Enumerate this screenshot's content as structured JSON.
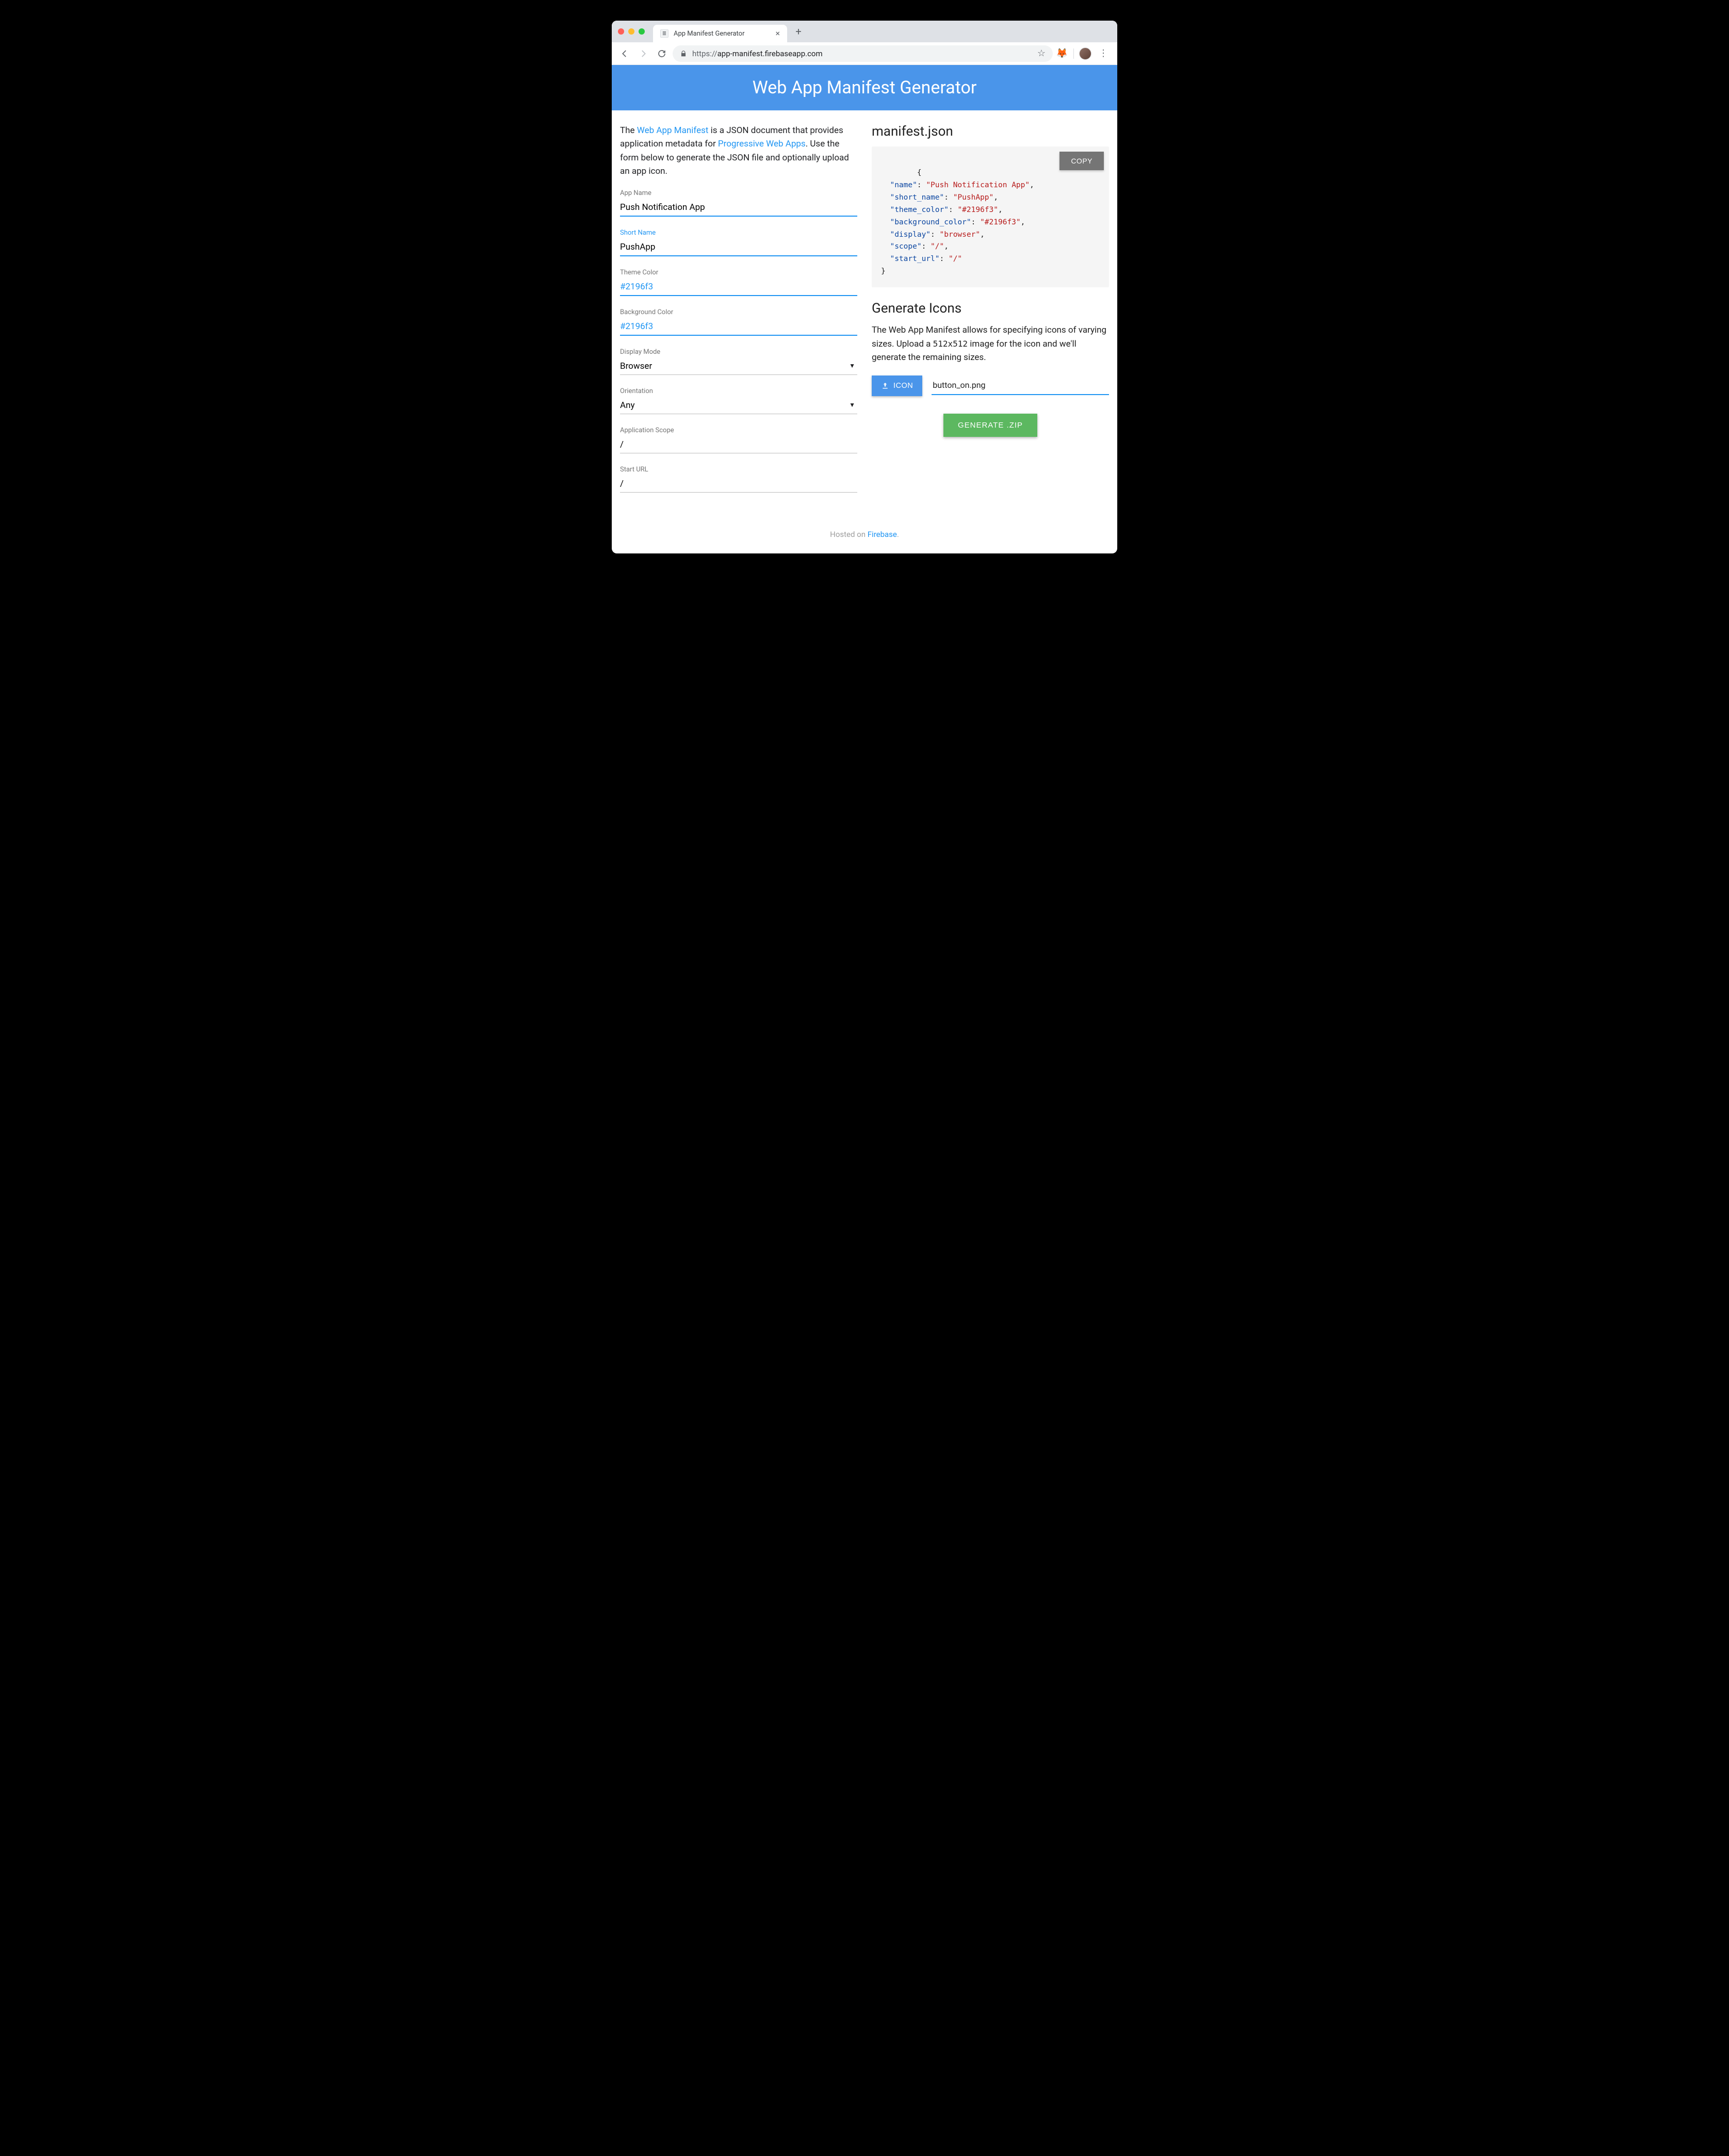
{
  "browser": {
    "tab_title": "App Manifest Generator",
    "url_display_prefix": "https://",
    "url_display": "app-manifest.firebaseapp.com"
  },
  "hero": {
    "title": "Web App Manifest Generator"
  },
  "intro": {
    "t1": "The ",
    "link1": "Web App Manifest",
    "t2": " is a JSON document that provides application metadata for ",
    "link2": "Progressive Web Apps",
    "t3": ". Use the form below to generate the JSON file and optionally upload an app icon."
  },
  "form": {
    "app_name": {
      "label": "App Name",
      "value": "Push Notification App"
    },
    "short_name": {
      "label": "Short Name",
      "value": "PushApp"
    },
    "theme_color": {
      "label": "Theme Color",
      "value": "#2196f3"
    },
    "background_color": {
      "label": "Background Color",
      "value": "#2196f3"
    },
    "display_mode": {
      "label": "Display Mode",
      "value": "Browser"
    },
    "orientation": {
      "label": "Orientation",
      "value": "Any"
    },
    "scope": {
      "label": "Application Scope",
      "value": "/"
    },
    "start_url": {
      "label": "Start URL",
      "value": "/"
    }
  },
  "output": {
    "heading": "manifest.json",
    "copy_label": "COPY",
    "json_pairs": [
      [
        "\"name\"",
        "\"Push Notification App\""
      ],
      [
        "\"short_name\"",
        "\"PushApp\""
      ],
      [
        "\"theme_color\"",
        "\"#2196f3\""
      ],
      [
        "\"background_color\"",
        "\"#2196f3\""
      ],
      [
        "\"display\"",
        "\"browser\""
      ],
      [
        "\"scope\"",
        "\"/\""
      ],
      [
        "\"start_url\"",
        "\"/\""
      ]
    ]
  },
  "icons": {
    "heading": "Generate Icons",
    "desc_t1": "The Web App Manifest allows for specifying icons of varying sizes. Upload a ",
    "desc_code": "512x512",
    "desc_t2": " image for the icon and we'll generate the remaining sizes.",
    "upload_label": "ICON",
    "file_name": "button_on.png",
    "generate_label": "GENERATE .ZIP"
  },
  "footer": {
    "t1": "Hosted on ",
    "link": "Firebase",
    "t2": "."
  }
}
